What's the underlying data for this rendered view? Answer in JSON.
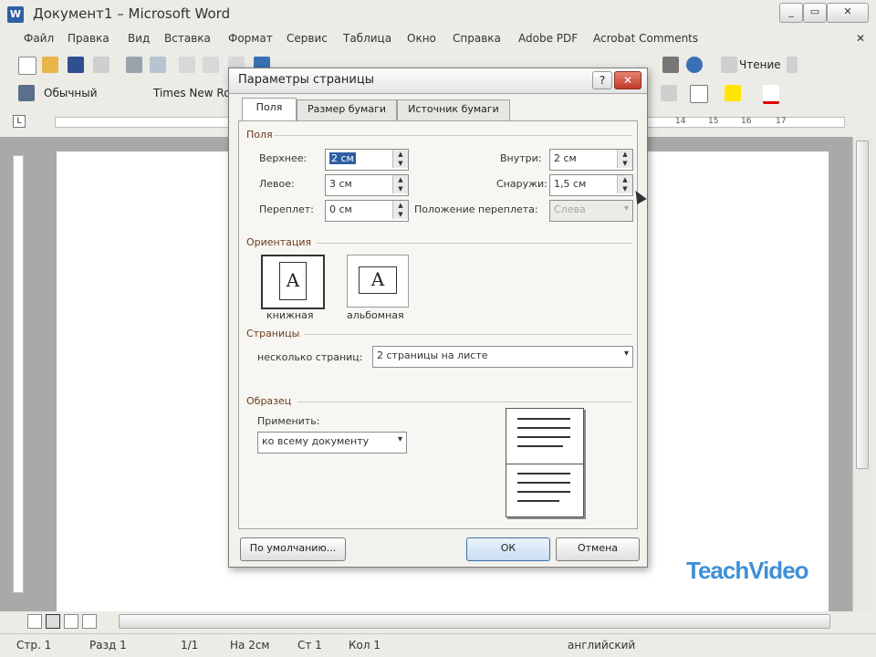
{
  "window": {
    "title": "Документ1 – Microsoft Word",
    "controls": {
      "minimize": "_",
      "restore": "▭",
      "close": "✕"
    }
  },
  "menu": {
    "items": [
      "Файл",
      "Правка",
      "Вид",
      "Вставка",
      "Формат",
      "Сервис",
      "Таблица",
      "Окно",
      "Справка",
      "Adobe PDF",
      "Acrobat Comments"
    ],
    "close_doc": "✕"
  },
  "toolbar": {
    "reading_label": "Чтение",
    "style_value": "Обычный",
    "font_value": "Times New Ro"
  },
  "ruler": {
    "ticks": [
      "14",
      "15",
      "16",
      "17"
    ]
  },
  "dialog": {
    "title": "Параметры страницы",
    "tabs": [
      "Поля",
      "Размер бумаги",
      "Источник бумаги"
    ],
    "margins": {
      "group": "Поля",
      "top_label": "Верхнее:",
      "top_value": "2 см",
      "left_label": "Левое:",
      "left_value": "3 см",
      "gutter_label": "Переплет:",
      "gutter_value": "0 см",
      "inside_label": "Внутри:",
      "inside_value": "2 см",
      "outside_label": "Снаружи:",
      "outside_value": "1,5 см",
      "gutter_pos_label": "Положение переплета:",
      "gutter_pos_value": "Слева"
    },
    "orientation": {
      "group": "Ориентация",
      "glyph": "A",
      "portrait": "книжная",
      "landscape": "альбомная"
    },
    "pages": {
      "group": "Страницы",
      "multiple_label": "несколько страниц:",
      "multiple_value": "2 страницы на листе"
    },
    "preview": {
      "group": "Образец",
      "apply_label": "Применить:",
      "apply_value": "ко всему документу"
    },
    "buttons": {
      "default": "По умолчанию...",
      "ok": "ОК",
      "cancel": "Отмена"
    }
  },
  "statusbar": {
    "page": "Стр. 1",
    "section": "Разд 1",
    "pages": "1/1",
    "position": "На 2см",
    "line": "Ст 1",
    "column": "Кол 1",
    "language": "английский"
  },
  "watermark": "TeachVideo",
  "colors": {
    "accent": "#3d6ea8",
    "group_label": "#6b3b1c",
    "watermark": "#3f8fd6"
  }
}
